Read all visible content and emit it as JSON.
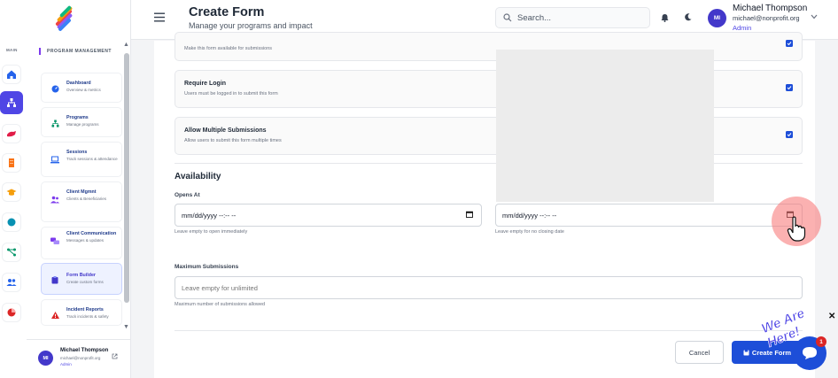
{
  "rail": {
    "label": "MAIN"
  },
  "sidebar": {
    "section_title": "PROGRAM MANAGEMENT",
    "items": [
      {
        "title": "Dashboard",
        "desc": "Overview & metrics",
        "icon": "gauge-icon"
      },
      {
        "title": "Programs",
        "desc": "Manage programs",
        "icon": "sitemap-icon"
      },
      {
        "title": "Sessions",
        "desc": "Track sessions & attendance",
        "icon": "laptop-icon"
      },
      {
        "title": "Client Mgmnt",
        "desc": "Clients & Beneficiaries",
        "icon": "users-icon"
      },
      {
        "title": "Client Communication",
        "desc": "Messages & updates",
        "icon": "comments-icon"
      },
      {
        "title": "Form Builder",
        "desc": "Create custom forms",
        "icon": "clipboard-icon"
      },
      {
        "title": "Incident Reports",
        "desc": "Track incidents & safety",
        "icon": "warning-icon"
      }
    ],
    "user": {
      "initials": "MI",
      "name": "Michael Thompson",
      "email": "michael@nonprofit.org",
      "role": "Admin"
    }
  },
  "header": {
    "title": "Create Form",
    "subtitle": "Manage your programs and impact",
    "search_placeholder": "Search...",
    "user": {
      "initials": "MI",
      "name": "Michael Thompson",
      "email": "michael@nonprofit.org",
      "role": "Admin"
    }
  },
  "form": {
    "options": [
      {
        "title": "",
        "desc": "Make this form available for submissions",
        "checked": true
      },
      {
        "title": "Require Login",
        "desc": "Users must be logged in to submit this form",
        "checked": true
      },
      {
        "title": "Allow Multiple Submissions",
        "desc": "Allow users to submit this form multiple times",
        "checked": true
      }
    ],
    "availability_title": "Availability",
    "opens_at": {
      "label": "Opens At",
      "value": "mm/dd/yyyy --:-- --",
      "hint": "Leave empty to open immediately"
    },
    "closes_at": {
      "value": "mm/dd/yyyy --:-- --",
      "hint": "Leave empty for no closing date"
    },
    "max_submissions": {
      "label": "Maximum Submissions",
      "placeholder": "Leave empty for unlimited",
      "hint": "Maximum number of submissions allowed"
    },
    "cancel_label": "Cancel",
    "create_label": "Create Form"
  },
  "chat": {
    "teaser": "We Are Here!",
    "badge": "1"
  },
  "colors": {
    "primary": "#1d4ed8",
    "accent": "#4f46e5",
    "cursor_highlight": "#f87171"
  }
}
